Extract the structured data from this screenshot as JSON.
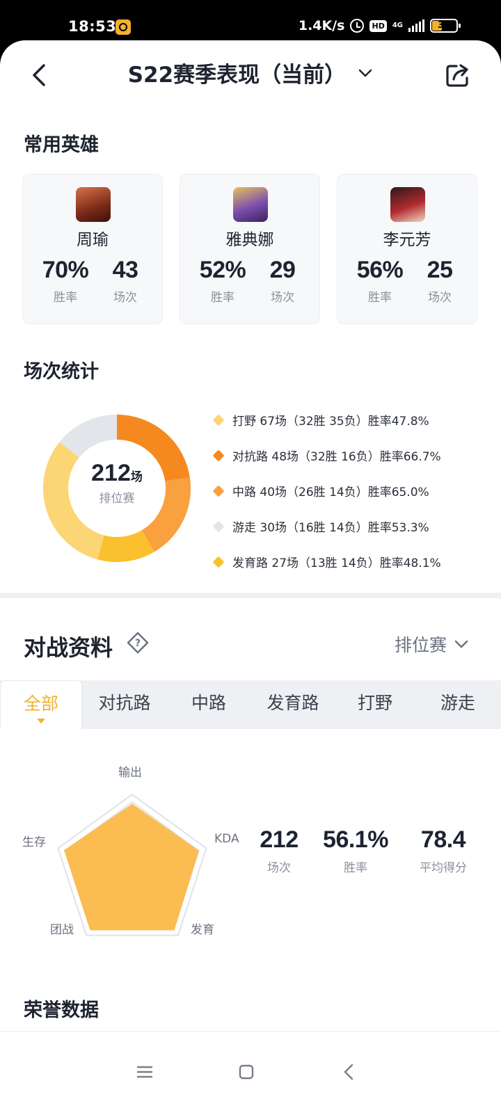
{
  "status_bar": {
    "time": "18:53",
    "net_speed": "1.4K/s",
    "hd": "HD",
    "network": "4G",
    "battery": "32"
  },
  "header": {
    "title": "S22赛季表现（当前）",
    "icons": [
      "back-icon",
      "chevron-down-icon",
      "share-icon"
    ]
  },
  "heroes": {
    "title": "常用英雄",
    "items": [
      {
        "name": "周瑜",
        "win_rate": "70%",
        "win_rate_label": "胜率",
        "games": "43",
        "games_label": "场次",
        "color": "#8a3a20"
      },
      {
        "name": "雅典娜",
        "win_rate": "52%",
        "win_rate_label": "胜率",
        "games": "29",
        "games_label": "场次",
        "color": "#6b3d8c"
      },
      {
        "name": "李元芳",
        "win_rate": "56%",
        "win_rate_label": "胜率",
        "games": "25",
        "games_label": "场次",
        "color": "#a02428"
      }
    ]
  },
  "match_stats": {
    "title": "场次统计",
    "total": "212",
    "unit": "场",
    "subtitle": "排位赛",
    "legend": [
      {
        "text": "打野 67场（32胜 35负）胜率47.8%",
        "role": "打野",
        "games": 67,
        "color": "#fcd575"
      },
      {
        "text": "对抗路 48场（32胜 16负）胜率66.7%",
        "role": "对抗路",
        "games": 48,
        "color": "#f5891f"
      },
      {
        "text": "中路 40场（26胜 14负）胜率65.0%",
        "role": "中路",
        "games": 40,
        "color": "#f9a03f"
      },
      {
        "text": "游走 30场（16胜 14负）胜率53.3%",
        "role": "游走",
        "games": 30,
        "color": "#e2e5e9"
      },
      {
        "text": "发育路 27场（13胜 14负）胜率48.1%",
        "role": "发育路",
        "games": 27,
        "color": "#fbc02d"
      }
    ]
  },
  "battle_data": {
    "title": "对战资料",
    "mode": "排位赛",
    "tabs": [
      "全部",
      "对抗路",
      "中路",
      "发育路",
      "打野",
      "游走"
    ],
    "active_tab": "全部",
    "radar": {
      "labels": [
        "输出",
        "KDA",
        "发育",
        "团战",
        "生存"
      ],
      "values": [
        0.88,
        0.9,
        0.92,
        0.92,
        0.92
      ],
      "color": "#fbbd52"
    },
    "summary": [
      {
        "value": "212",
        "label": "场次"
      },
      {
        "value": "56.1%",
        "label": "胜率"
      },
      {
        "value": "78.4",
        "label": "平均得分"
      }
    ]
  },
  "honor": {
    "title": "荣誉数据"
  },
  "nav_bar": {
    "icons": [
      "menu-icon",
      "home-icon",
      "back-nav-icon"
    ]
  }
}
